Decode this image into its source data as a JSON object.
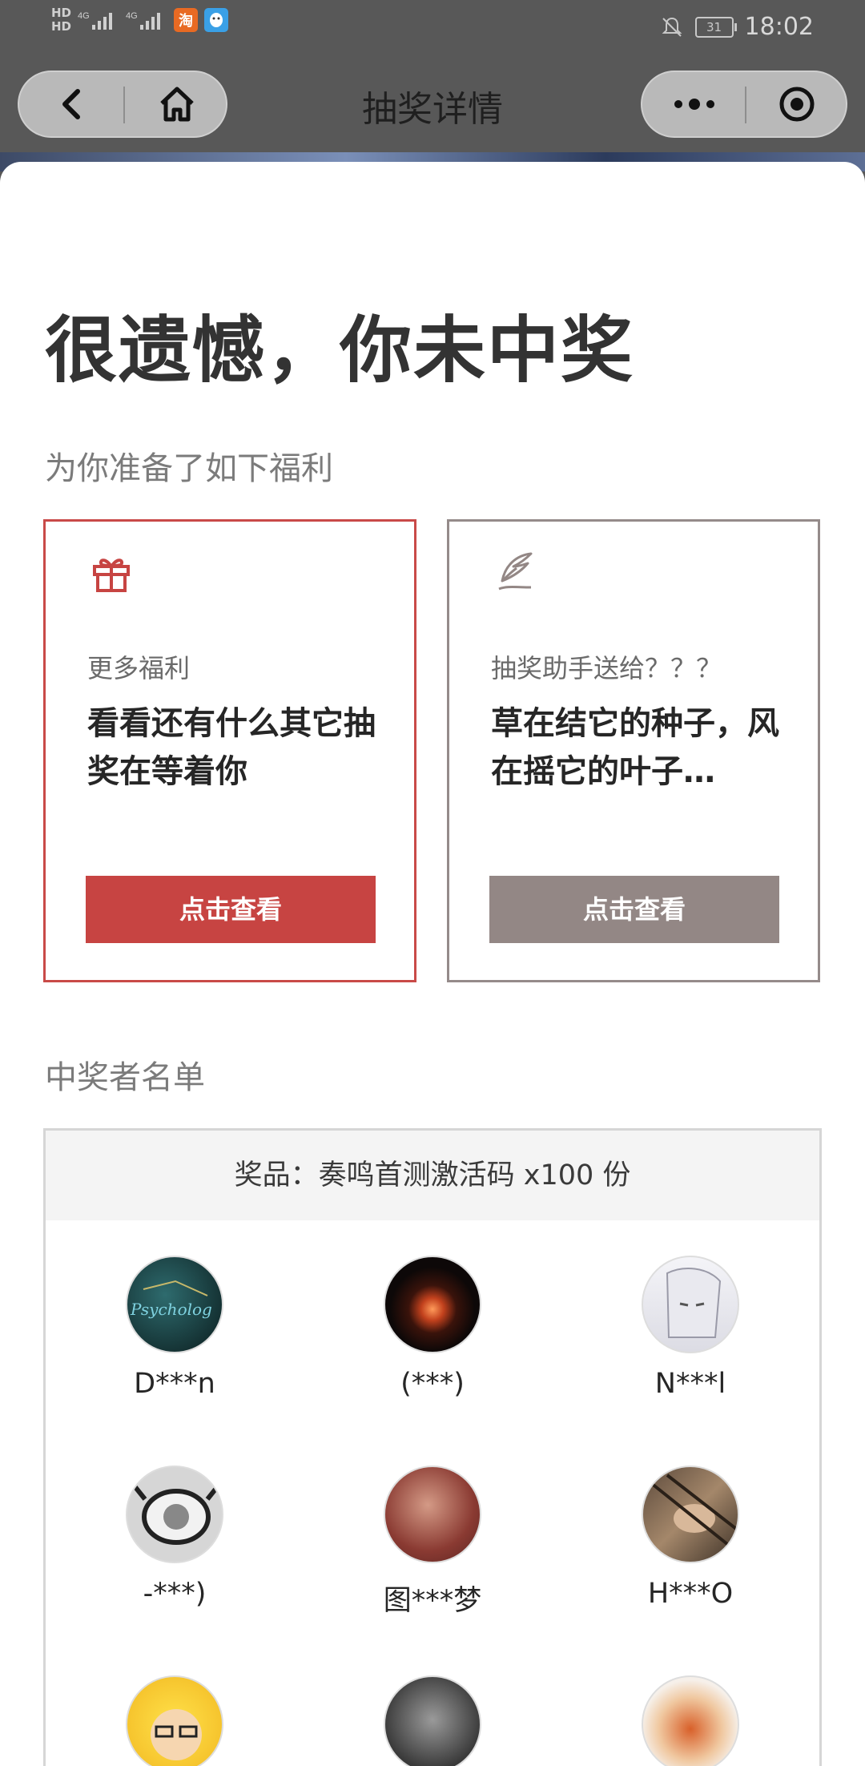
{
  "status_bar": {
    "hd_top": "HD",
    "hd_bottom": "HD",
    "net1": "4G",
    "net2": "4G",
    "battery": "31",
    "time": "18:02",
    "taobao_glyph": "淘"
  },
  "nav": {
    "title": "抽奖详情",
    "back_icon": "chevron-left-icon",
    "home_icon": "home-icon",
    "more_icon": "more-dots-icon",
    "close_icon": "target-icon"
  },
  "result": {
    "headline": "很遗憾，你未中奖",
    "benefits_label": "为你准备了如下福利"
  },
  "cards": [
    {
      "icon": "gift-icon",
      "subtitle": "更多福利",
      "body": "看看还有什么其它抽奖在等着你",
      "cta": "点击查看",
      "color": "#c74442"
    },
    {
      "icon": "feather-icon",
      "subtitle": "抽奖助手送给？？？",
      "body": "草在结它的种子，风在摇它的叶子…",
      "cta": "点击查看",
      "color": "#938785"
    }
  ],
  "winners": {
    "label": "中奖者名单",
    "prize": "奖品：奏鸣首测激活码 x100 份",
    "list": [
      {
        "name": "D***n",
        "avatar_color": "#1d3a3a"
      },
      {
        "name": "(***)",
        "avatar_color": "#1a0f0c"
      },
      {
        "name": "N***l",
        "avatar_color": "#e9e9ef"
      },
      {
        "name": "-***)",
        "avatar_color": "#d9d9d9"
      },
      {
        "name": "图***梦",
        "avatar_color": "#a35a50"
      },
      {
        "name": "H***O",
        "avatar_color": "#7a6a5a"
      },
      {
        "name": "",
        "avatar_color": "#f0d040"
      },
      {
        "name": "",
        "avatar_color": "#6a6a6a"
      },
      {
        "name": "",
        "avatar_color": "#e8c0a0"
      }
    ]
  }
}
